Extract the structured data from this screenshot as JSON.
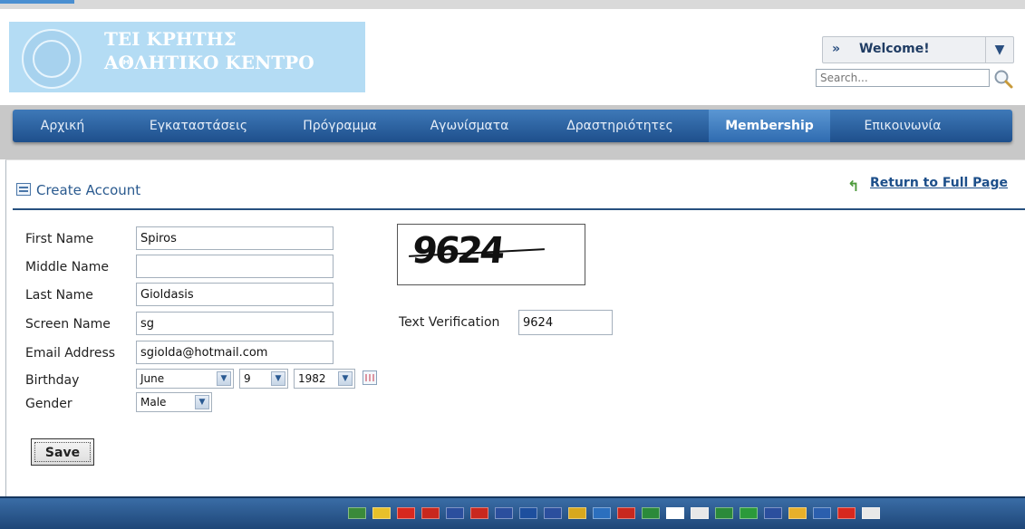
{
  "header": {
    "logo_line1": "ΤΕΙ ΚΡΗΤΗΣ",
    "logo_line2": "ΑΘΛΗΤΙΚΟ ΚΕΝΤΡΟ",
    "welcome_label": "Welcome!",
    "search_placeholder": "Search..."
  },
  "nav": {
    "items": [
      {
        "label": "Αρχική"
      },
      {
        "label": "Εγκαταστάσεις"
      },
      {
        "label": "Πρόγραμμα"
      },
      {
        "label": "Αγωνίσματα"
      },
      {
        "label": "Δραστηριότητες"
      },
      {
        "label": "Membership",
        "active": true
      },
      {
        "label": "Επικοινωνία"
      }
    ]
  },
  "section": {
    "title": "Create Account",
    "return_link": "Return to Full Page"
  },
  "form": {
    "first_name_label": "First Name",
    "first_name_value": "Spiros",
    "middle_name_label": "Middle Name",
    "middle_name_value": "",
    "last_name_label": "Last Name",
    "last_name_value": "Gioldasis",
    "screen_name_label": "Screen Name",
    "screen_name_value": "sg",
    "email_label": "Email Address",
    "email_value": "sgiolda@hotmail.com",
    "birthday_label": "Birthday",
    "birthday_month": "June",
    "birthday_day": "9",
    "birthday_year": "1982",
    "gender_label": "Gender",
    "gender_value": "Male",
    "save_label": "Save"
  },
  "captcha": {
    "image_text": "9624",
    "verification_label": "Text Verification",
    "verification_value": "9624"
  },
  "colors": {
    "nav_bg": "#2a5f9e",
    "accent": "#1d4f8a",
    "logo_bg": "#b4dcf4"
  },
  "footer": {
    "flags": [
      {
        "name": "arabic-flag",
        "color": "#3a8a3a"
      },
      {
        "name": "catalan-flag",
        "color": "#e8c02a"
      },
      {
        "name": "chinese-flag",
        "color": "#d8281e"
      },
      {
        "name": "taiwanese-flag",
        "color": "#c8281e"
      },
      {
        "name": "czech-flag",
        "color": "#2b4f9e"
      },
      {
        "name": "dutch-flag",
        "color": "#c8281e"
      },
      {
        "name": "english-flag",
        "color": "#2b4f9e"
      },
      {
        "name": "finnish-flag",
        "color": "#1d4f9e"
      },
      {
        "name": "french-flag",
        "color": "#2b4f9e"
      },
      {
        "name": "german-flag",
        "color": "#d8a81e"
      },
      {
        "name": "greek-flag",
        "color": "#2b6fbe"
      },
      {
        "name": "hungarian-flag",
        "color": "#c8281e"
      },
      {
        "name": "italian-flag",
        "color": "#2b8a3a"
      },
      {
        "name": "japanese-flag",
        "color": "#ffffff"
      },
      {
        "name": "korean-flag",
        "color": "#e8e8e8"
      },
      {
        "name": "persian-flag",
        "color": "#2b8a3a"
      },
      {
        "name": "portuguese-flag",
        "color": "#2b9a3a"
      },
      {
        "name": "russian-flag",
        "color": "#2b4f9e"
      },
      {
        "name": "spanish-flag",
        "color": "#e8b02a"
      },
      {
        "name": "swedish-flag",
        "color": "#2b5fae"
      },
      {
        "name": "turkish-flag",
        "color": "#d8281e"
      },
      {
        "name": "vietnamese-flag",
        "color": "#e8e8e8"
      }
    ]
  }
}
